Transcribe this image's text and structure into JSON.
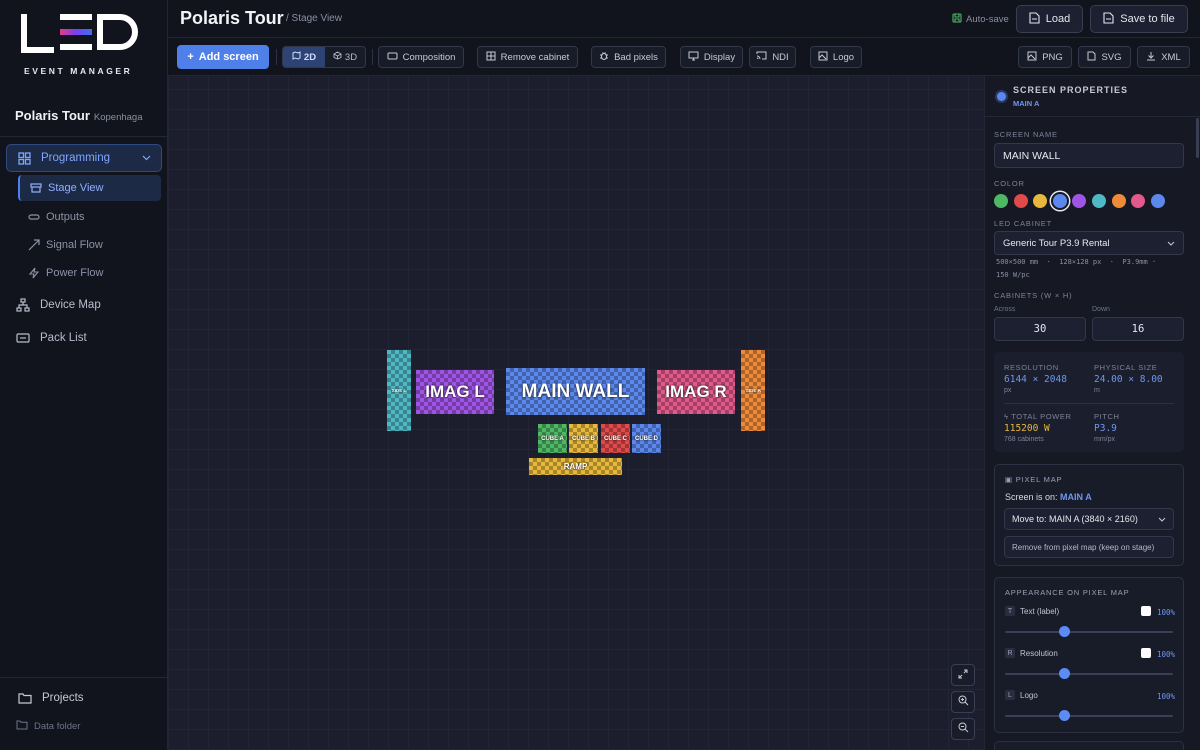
{
  "app": {
    "logo_text": "LED",
    "logo_subtitle": "EVENT MANAGER"
  },
  "project": {
    "name": "Polaris Tour",
    "location": "Kopenhaga"
  },
  "sidebar": {
    "items": [
      {
        "label": "Programming",
        "icon": "grid-icon"
      },
      {
        "label": "Device Map",
        "icon": "network-icon"
      },
      {
        "label": "Pack List",
        "icon": "list-icon"
      }
    ],
    "sub_items": [
      {
        "label": "Stage View",
        "icon": "stage-icon"
      },
      {
        "label": "Outputs",
        "icon": "outputs-icon"
      },
      {
        "label": "Signal Flow",
        "icon": "signal-icon"
      },
      {
        "label": "Power Flow",
        "icon": "bolt-icon"
      }
    ],
    "footer": {
      "projects": "Projects",
      "data_folder": "Data folder"
    }
  },
  "header": {
    "title": "Polaris Tour",
    "breadcrumb": "/ Stage View",
    "autosave": "Auto-save",
    "load": "Load",
    "save": "Save to file"
  },
  "toolbar": {
    "add_screen": "Add screen",
    "view_2d": "2D",
    "view_3d": "3D",
    "composition": "Composition",
    "remove_cabinet": "Remove cabinet",
    "bad_pixels": "Bad pixels",
    "display": "Display",
    "ndi": "NDI",
    "logo": "Logo",
    "png": "PNG",
    "svg": "SVG",
    "xml": "XML"
  },
  "stage": {
    "screens": [
      {
        "label": "SIDE L",
        "color": "#4fb8c4"
      },
      {
        "label": "IMAG L",
        "color": "#a054e6"
      },
      {
        "label": "MAIN WALL",
        "color": "#5c88ee"
      },
      {
        "label": "IMAG R",
        "color": "#e25a8c"
      },
      {
        "label": "SIDE R",
        "color": "#ee8a3a"
      },
      {
        "label": "CUBE A",
        "color": "#4fb865"
      },
      {
        "label": "CUBE B",
        "color": "#e8b83c"
      },
      {
        "label": "CUBE C",
        "color": "#e04a4a"
      },
      {
        "label": "CUBE D",
        "color": "#5c88ee"
      },
      {
        "label": "RAMP",
        "color": "#e8b83c"
      }
    ]
  },
  "panel": {
    "header": "SCREEN PROPERTIES",
    "subheader": "MAIN A",
    "screen_name_label": "SCREEN NAME",
    "screen_name": "MAIN WALL",
    "color_label": "COLOR",
    "colors": [
      "#4fb865",
      "#e04a4a",
      "#e8b83c",
      "#5c88ee",
      "#a054e6",
      "#4fb8c4",
      "#ee8a3a",
      "#e25a8c",
      "#5c88ee"
    ],
    "cabinet_label": "LED CABINET",
    "cabinet": "Generic Tour P3.9 Rental",
    "cabinet_spec_1": "500×500 mm  ·  128×128 px  ·  P3.9mm ·",
    "cabinet_spec_2": "150 W/pc",
    "cabinets_label": "CABINETS (W × H)",
    "across_label": "Across",
    "down_label": "Down",
    "across": "30",
    "down": "16",
    "resolution_label": "RESOLUTION",
    "resolution": "6144 × 2048",
    "resolution_unit": "px",
    "physical_label": "PHYSICAL SIZE",
    "physical": "24.00 × 8.00",
    "physical_unit": "m",
    "power_label": "TOTAL POWER",
    "power": "115200 W",
    "power_unit": "768 cabinets",
    "pitch_label": "PITCH",
    "pitch": "P3.9",
    "pitch_unit": "mm/px",
    "pixelmap": {
      "title": "PIXEL MAP",
      "screen_on_prefix": "Screen is on:",
      "screen_on_value": "MAIN A",
      "move_to": "Move to: MAIN A (3840 × 2160)",
      "remove": "Remove from pixel map (keep on stage)"
    },
    "appearance": {
      "title": "APPEARANCE ON PIXEL MAP",
      "rows": [
        {
          "key": "T",
          "label": "Text (label)",
          "value": "100%",
          "level": 0.35
        },
        {
          "key": "R",
          "label": "Resolution",
          "value": "100%",
          "level": 0.35
        },
        {
          "key": "L",
          "label": "Logo",
          "value": "100%",
          "level": 0.35
        }
      ]
    }
  }
}
